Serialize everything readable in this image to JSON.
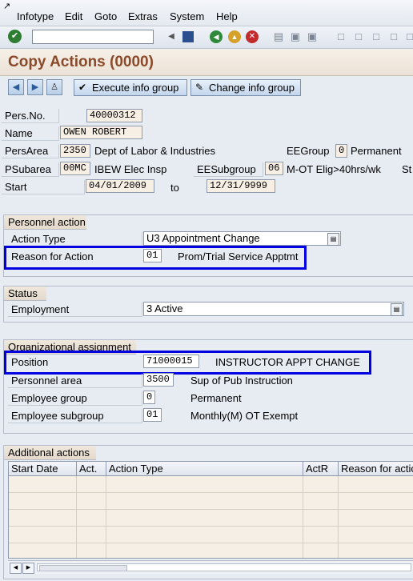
{
  "menu": {
    "items": [
      {
        "label": "Infotype"
      },
      {
        "label": "Edit"
      },
      {
        "label": "Goto"
      },
      {
        "label": "Extras"
      },
      {
        "label": "System"
      },
      {
        "label": "Help"
      }
    ]
  },
  "toolbar": {
    "command_value": ""
  },
  "title": "Copy Actions (0000)",
  "app_toolbar": {
    "execute_label": "Execute info group",
    "change_label": "Change info group"
  },
  "header": {
    "persno_label": "Pers.No.",
    "persno_value": "40000312",
    "name_label": "Name",
    "name_value": "OWEN ROBERT",
    "persarea_label": "PersArea",
    "persarea_code": "2350",
    "persarea_text": "Dept of Labor & Industries",
    "eegroup_label": "EEGroup",
    "eegroup_code": "0",
    "eegroup_text": "Permanent",
    "psubarea_label": "PSubarea",
    "psubarea_code": "00MC",
    "psubarea_text": "IBEW Elec Insp",
    "eesubgroup_label": "EESubgroup",
    "eesubgroup_code": "06",
    "eesubgroup_text": "M-OT Elig>40hrs/wk",
    "trailing_label": "St",
    "start_label": "Start",
    "start_value": "04/01/2009",
    "to_label": "to",
    "end_value": "12/31/9999"
  },
  "personnel_action": {
    "title": "Personnel action",
    "action_type_label": "Action Type",
    "action_type_value": "U3 Appointment Change",
    "reason_label": "Reason for Action",
    "reason_code": "01",
    "reason_text": "Prom/Trial Service Apptmt"
  },
  "status": {
    "title": "Status",
    "employment_label": "Employment",
    "employment_value": "3 Active"
  },
  "org_assignment": {
    "title": "Organizational assignment",
    "position_label": "Position",
    "position_value": "71000015",
    "position_text": "INSTRUCTOR APPT CHANGE",
    "personnel_area_label": "Personnel area",
    "personnel_area_value": "3500",
    "personnel_area_text": "Sup of Pub Instruction",
    "employee_group_label": "Employee group",
    "employee_group_value": "0",
    "employee_group_text": "Permanent",
    "employee_subgroup_label": "Employee subgroup",
    "employee_subgroup_value": "01",
    "employee_subgroup_text": "Monthly(M) OT Exempt"
  },
  "additional_actions": {
    "title": "Additional actions",
    "columns": [
      "Start Date",
      "Act.",
      "Action Type",
      "ActR",
      "Reason for actio"
    ]
  },
  "icons": {
    "enter": "check-icon",
    "save": "save-icon",
    "back": "back-icon",
    "exit": "exit-icon",
    "cancel": "cancel-icon"
  }
}
